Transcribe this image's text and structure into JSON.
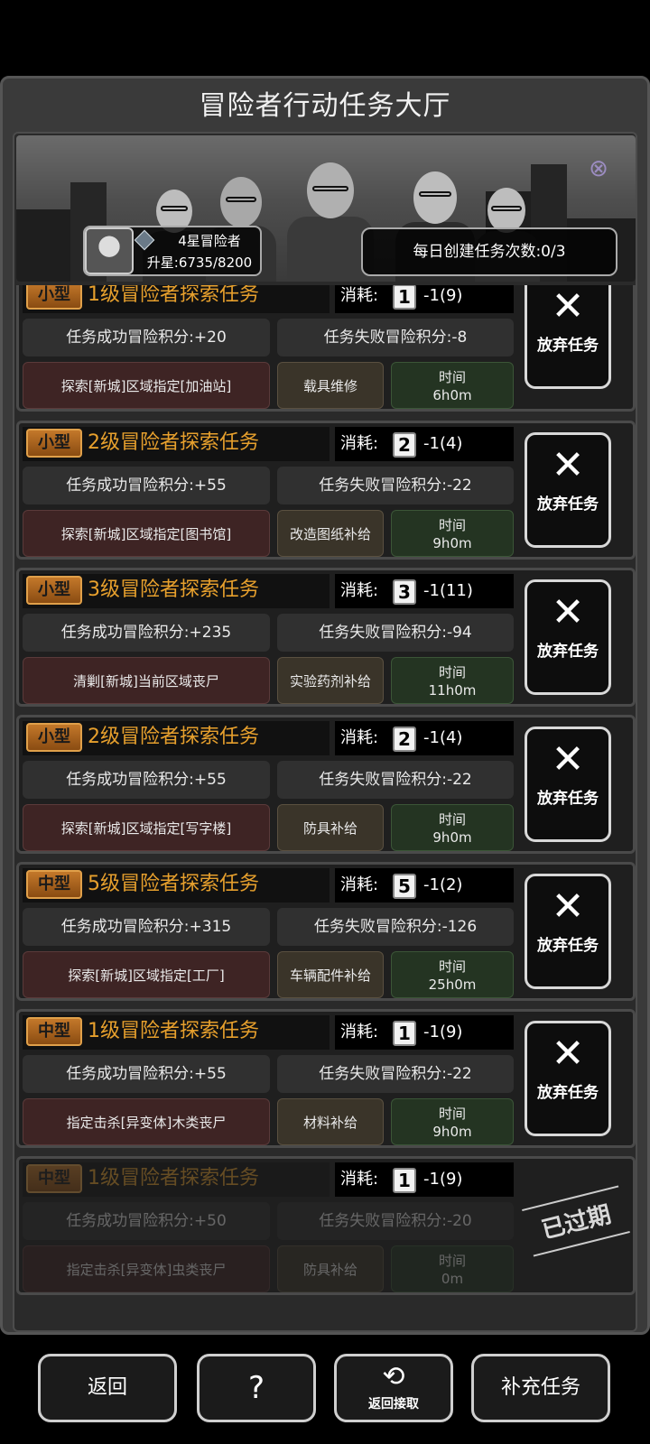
{
  "header": {
    "title": "冒险者行动任务大厅"
  },
  "profile": {
    "rank": "4星冒险者",
    "star_progress": "升星:6735/8200"
  },
  "daily": {
    "label": "每日创建任务次数:0/3"
  },
  "tasks": [
    {
      "type": "小型",
      "title": "1级冒险者探索任务",
      "cost_label": "消耗:",
      "lv": "1",
      "cost": "-1(9)",
      "success": "任务成功冒险积分:+20",
      "fail": "任务失败冒险积分:-8",
      "location": "探索[新城]区域指定[加油站]",
      "reward": "载具维修",
      "time_label": "时间",
      "time": "6h0m",
      "action": "放弃任务"
    },
    {
      "type": "小型",
      "title": "2级冒险者探索任务",
      "cost_label": "消耗:",
      "lv": "2",
      "cost": "-1(4)",
      "success": "任务成功冒险积分:+55",
      "fail": "任务失败冒险积分:-22",
      "location": "探索[新城]区域指定[图书馆]",
      "reward": "改造图纸补给",
      "time_label": "时间",
      "time": "9h0m",
      "action": "放弃任务"
    },
    {
      "type": "小型",
      "title": "3级冒险者探索任务",
      "cost_label": "消耗:",
      "lv": "3",
      "cost": "-1(11)",
      "success": "任务成功冒险积分:+235",
      "fail": "任务失败冒险积分:-94",
      "location": "清剿[新城]当前区域丧尸",
      "reward": "实验药剂补给",
      "time_label": "时间",
      "time": "11h0m",
      "action": "放弃任务"
    },
    {
      "type": "小型",
      "title": "2级冒险者探索任务",
      "cost_label": "消耗:",
      "lv": "2",
      "cost": "-1(4)",
      "success": "任务成功冒险积分:+55",
      "fail": "任务失败冒险积分:-22",
      "location": "探索[新城]区域指定[写字楼]",
      "reward": "防具补给",
      "time_label": "时间",
      "time": "9h0m",
      "action": "放弃任务"
    },
    {
      "type": "中型",
      "title": "5级冒险者探索任务",
      "cost_label": "消耗:",
      "lv": "5",
      "cost": "-1(2)",
      "success": "任务成功冒险积分:+315",
      "fail": "任务失败冒险积分:-126",
      "location": "探索[新城]区域指定[工厂]",
      "reward": "车辆配件补给",
      "time_label": "时间",
      "time": "25h0m",
      "action": "放弃任务"
    },
    {
      "type": "中型",
      "title": "1级冒险者探索任务",
      "cost_label": "消耗:",
      "lv": "1",
      "cost": "-1(9)",
      "success": "任务成功冒险积分:+55",
      "fail": "任务失败冒险积分:-22",
      "location": "指定击杀[异变体]木类丧尸",
      "reward": "材料补给",
      "time_label": "时间",
      "time": "9h0m",
      "action": "放弃任务"
    },
    {
      "type": "中型",
      "title": "1级冒险者探索任务",
      "cost_label": "消耗:",
      "lv": "1",
      "cost": "-1(9)",
      "success": "任务成功冒险积分:+50",
      "fail": "任务失败冒险积分:-20",
      "location": "指定击杀[异变体]虫类丧尸",
      "reward": "防具补给",
      "time_label": "时间",
      "time": "0m",
      "status": "已过期"
    }
  ],
  "footer": {
    "back": "返回",
    "return_accept": "返回接取",
    "add_task": "补充任务"
  },
  "colors": {
    "accent_orange": "#e7a02d",
    "badge_orange": "#c3782a",
    "location_bg": "#3e2424",
    "time_bg": "#243422"
  }
}
